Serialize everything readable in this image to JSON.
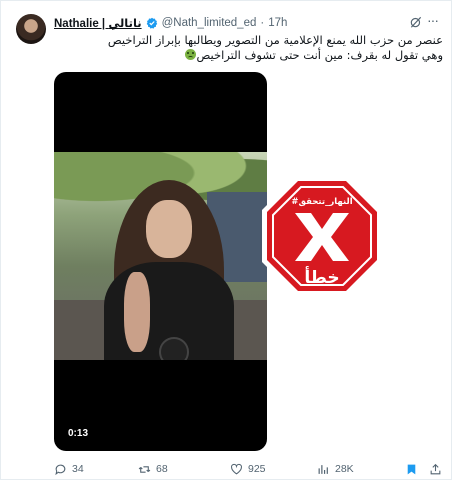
{
  "author": {
    "display_name": "Nathalie | ناتالي",
    "handle": "@Nath_limited_ed",
    "separator": "·",
    "timestamp": "17h",
    "verified": true
  },
  "tweet": {
    "line1": "عنصر من حزب الله يمنع الإعلامية من التصوير ويطالبها بإبراز التراخيص",
    "line2": "وهي تقول له بقرف: مين أنت حتى تشوف التراخيص"
  },
  "video": {
    "duration": "0:13"
  },
  "stamp": {
    "hashtag": "#النهار_تتحقق",
    "verdict": "خطأ",
    "color": "#d71920"
  },
  "actions": {
    "replies": "34",
    "retweets": "68",
    "likes": "925",
    "views": "28K"
  },
  "icons": {
    "verified": "verified-badge-icon",
    "grok": "grok-icon",
    "more": "more-icon",
    "reply": "reply-icon",
    "retweet": "retweet-icon",
    "like": "heart-icon",
    "views": "views-icon",
    "bookmark": "bookmark-icon",
    "share": "share-icon"
  },
  "colors": {
    "accent": "#1d9bf0",
    "muted": "#536471",
    "text": "#0f1419"
  }
}
